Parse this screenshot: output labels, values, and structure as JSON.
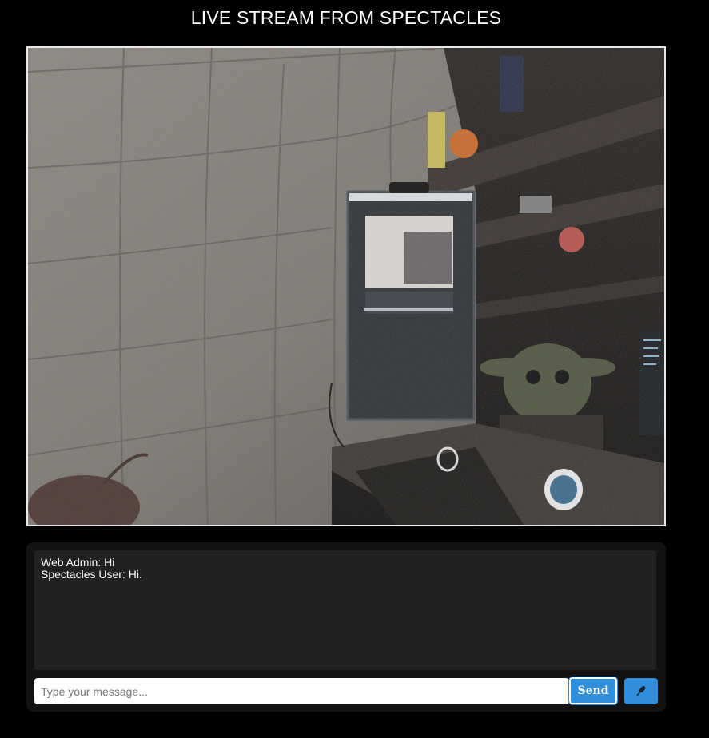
{
  "header": {
    "title": "LIVE STREAM FROM SPECTACLES"
  },
  "video": {
    "label": "live-stream-video"
  },
  "chat": {
    "messages": [
      "Web Admin: Hi",
      "Spectacles User: Hi."
    ],
    "input": {
      "value": "",
      "placeholder": "Type your message..."
    },
    "send_label": "Send",
    "mic_icon": "microphone-icon"
  },
  "colors": {
    "background": "#000000",
    "panel": "#121212",
    "chat_log": "#212121",
    "accent": "#2f8fdc"
  }
}
